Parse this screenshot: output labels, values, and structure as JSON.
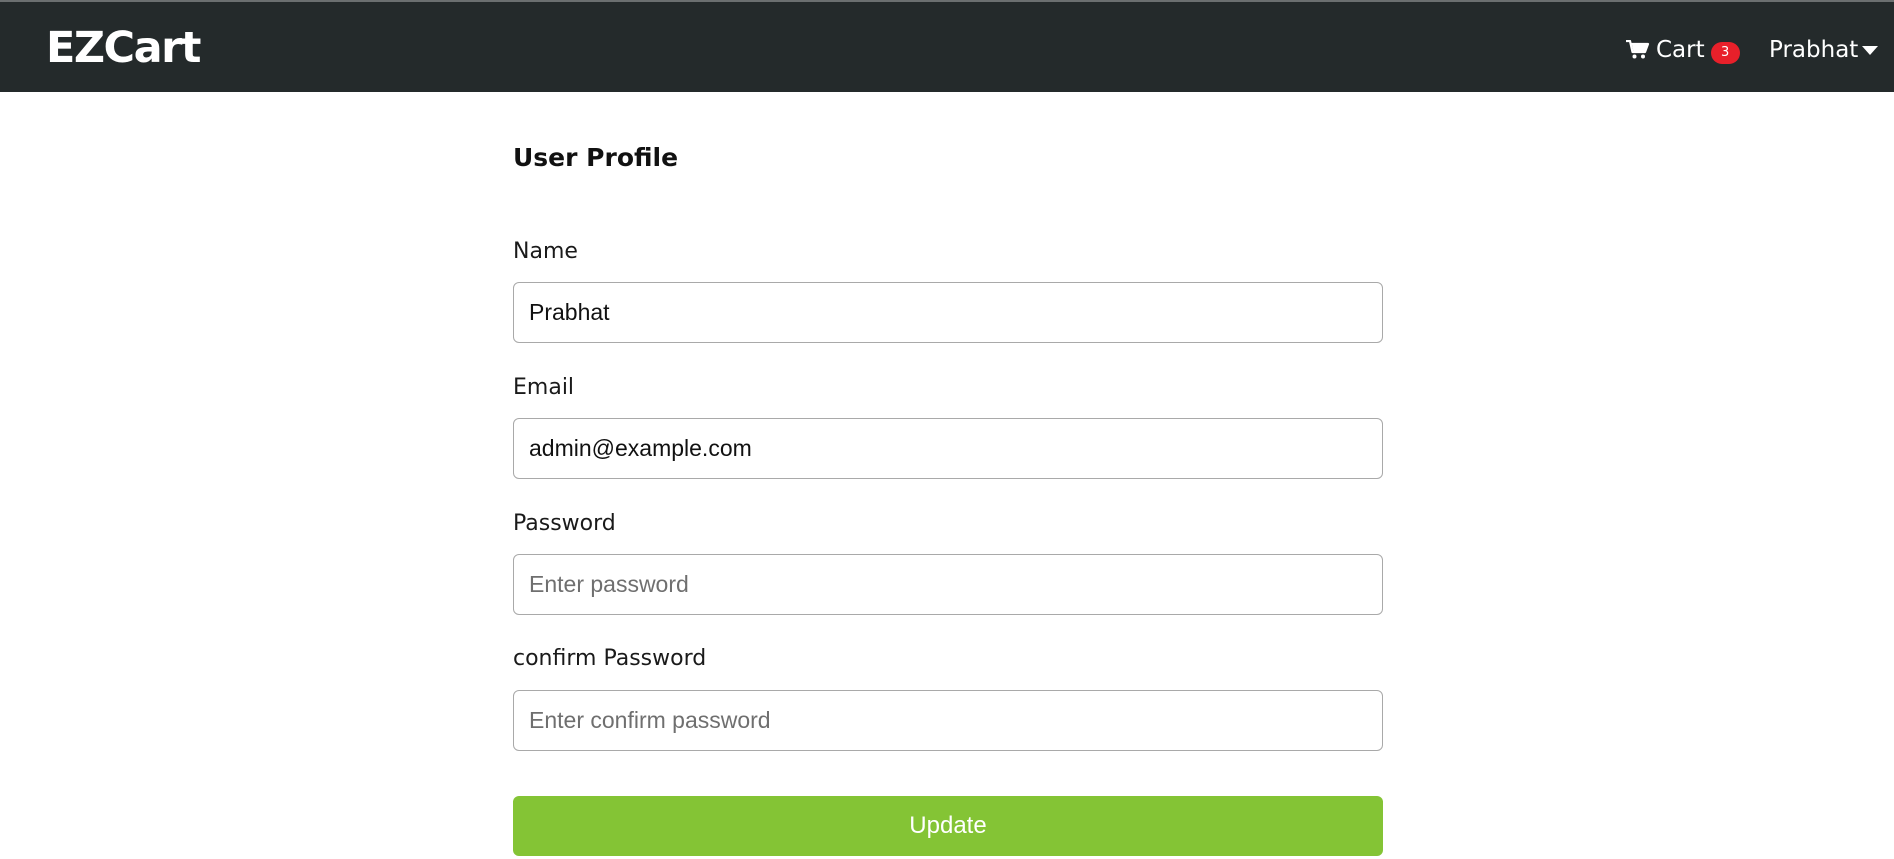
{
  "navbar": {
    "brand": "EZCart",
    "cart": {
      "icon": "shopping-cart-icon",
      "label": "Cart",
      "count": "3"
    },
    "user": {
      "name": "Prabhat",
      "icon": "caret-down-icon"
    }
  },
  "profile": {
    "title": "User Profile",
    "name": {
      "label": "Name",
      "value": "Prabhat"
    },
    "email": {
      "label": "Email",
      "value": "admin@example.com"
    },
    "password": {
      "label": "Password",
      "placeholder": "Enter password"
    },
    "confirm_password": {
      "label": "confirm Password",
      "placeholder": "Enter confirm password"
    },
    "submit_label": "Update"
  },
  "colors": {
    "navbar_bg": "#242a2b",
    "cart_badge": "#e8202a",
    "update_button": "#84c435"
  }
}
